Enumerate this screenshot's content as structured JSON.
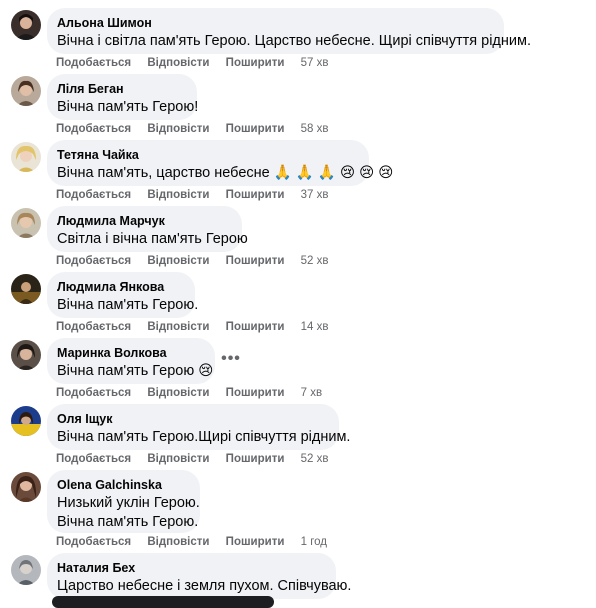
{
  "actions": {
    "like": "Подобається",
    "reply": "Відповісти",
    "share": "Поширити"
  },
  "more_label": "•••",
  "comments": [
    {
      "author": "Альона Шимон",
      "lines": [
        "Вічна і світла пам'ять Герою. Царство небесне. Щирі співчуття рідним."
      ],
      "time": "57 хв",
      "avatar": "avatar-dark-hair"
    },
    {
      "author": "Ліля Беган",
      "lines": [
        "Вічна пам'ять Герою!"
      ],
      "time": "58 хв",
      "avatar": "avatar-brown-hair"
    },
    {
      "author": "Тетяна Чайка",
      "lines": [
        "Вічна пам'ять, царство небесне 🙏 🙏 🙏 😢 😢 😢"
      ],
      "time": "37 хв",
      "avatar": "avatar-blonde"
    },
    {
      "author": "Людмила Марчук",
      "lines": [
        "Світла і вічна пам'ять Герою"
      ],
      "time": "52 хв",
      "avatar": "avatar-light-hair"
    },
    {
      "author": "Людмила Янкова",
      "lines": [
        "Вічна пам'ять Герою."
      ],
      "time": "14 хв",
      "avatar": "avatar-dark-scene"
    },
    {
      "author": "Маринка Волкова",
      "lines": [
        "Вічна пам'ять Герою 😢"
      ],
      "time": "7 хв",
      "avatar": "avatar-dark-hair-2"
    },
    {
      "author": "Оля Іщук",
      "lines": [
        "Вічна пам'ять Герою.Щирі співчуття рідним."
      ],
      "time": "52 хв",
      "avatar": "avatar-blue-flag"
    },
    {
      "author": "Olena Galchinska",
      "lines": [
        "Низький уклін Герою.",
        "Вічна пам'ять Герою."
      ],
      "time": "1 год",
      "avatar": "avatar-long-hair"
    },
    {
      "author": "Наталия Бех",
      "lines": [
        "Царство небесне і земля пухом. Співчуваю."
      ],
      "time": "",
      "avatar": "avatar-gray"
    }
  ],
  "colors": {
    "bubble": "#f0f2f5",
    "action_text": "#65676b",
    "text": "#050505"
  }
}
